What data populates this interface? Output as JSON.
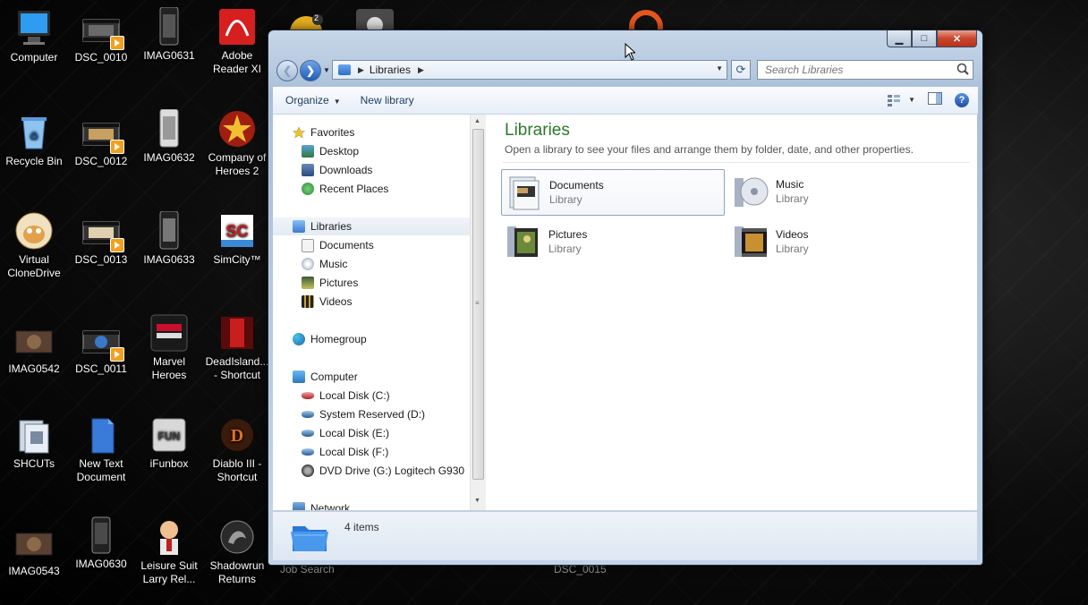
{
  "desktop": {
    "icons": [
      {
        "label": "Computer"
      },
      {
        "label": "DSC_0010"
      },
      {
        "label": "IMAG0631"
      },
      {
        "label": "Adobe Reader XI"
      },
      {
        "label": "Recycle Bin"
      },
      {
        "label": "DSC_0012"
      },
      {
        "label": "IMAG0632"
      },
      {
        "label": "Company of Heroes 2"
      },
      {
        "label": "Virtual CloneDrive"
      },
      {
        "label": "DSC_0013"
      },
      {
        "label": "IMAG0633"
      },
      {
        "label": "SimCity™"
      },
      {
        "label": "IMAG0542"
      },
      {
        "label": "DSC_0011"
      },
      {
        "label": "Marvel Heroes"
      },
      {
        "label": "DeadIsland... - Shortcut"
      },
      {
        "label": "SHCUTs"
      },
      {
        "label": "New Text Document"
      },
      {
        "label": "iFunbox"
      },
      {
        "label": "Diablo III - Shortcut"
      },
      {
        "label": "IMAG0543"
      },
      {
        "label": "IMAG0630"
      },
      {
        "label": "Leisure Suit Larry Rel..."
      },
      {
        "label": "Shadowrun Returns"
      }
    ],
    "hidden_labels": [
      "Job Search",
      "DSC_0015"
    ],
    "tray_badge": "2"
  },
  "window": {
    "address": {
      "segment": "Libraries"
    },
    "search": {
      "placeholder": "Search Libraries"
    },
    "toolbar": {
      "organize": "Organize",
      "new_library": "New library"
    },
    "nav": {
      "favorites": "Favorites",
      "favorites_items": [
        "Desktop",
        "Downloads",
        "Recent Places"
      ],
      "libraries": "Libraries",
      "libraries_items": [
        "Documents",
        "Music",
        "Pictures",
        "Videos"
      ],
      "homegroup": "Homegroup",
      "computer": "Computer",
      "computer_items": [
        "Local Disk (C:)",
        "System Reserved (D:)",
        "Local Disk (E:)",
        "Local Disk (F:)",
        "DVD Drive (G:) Logitech G930"
      ],
      "network": "Network"
    },
    "content": {
      "title": "Libraries",
      "subtitle": "Open a library to see your files and arrange them by folder, date, and other properties.",
      "libraries": [
        {
          "name": "Documents",
          "type": "Library"
        },
        {
          "name": "Music",
          "type": "Library"
        },
        {
          "name": "Pictures",
          "type": "Library"
        },
        {
          "name": "Videos",
          "type": "Library"
        }
      ]
    },
    "details": {
      "count": "4 items"
    }
  },
  "colors": {
    "title_green": "#2b7a2b",
    "link_blue": "#1e3a5f"
  }
}
